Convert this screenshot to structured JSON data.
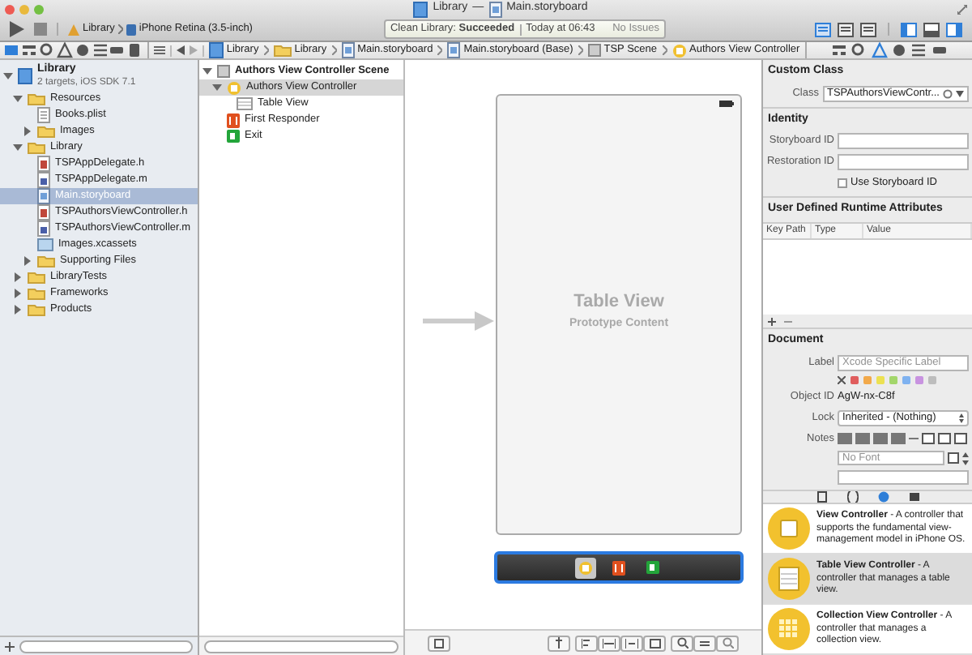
{
  "window": {
    "project": "Library",
    "separator": "—",
    "file": "Main.storyboard"
  },
  "toolbar": {
    "scheme_target": "Library",
    "scheme_device": "iPhone Retina (3.5-inch)",
    "activity": "Clean Library: **Succeeded**",
    "time": "Today at 06:43",
    "issues": "No Issues",
    "editor_modes": [
      {
        "selected": true
      },
      {
        "selected": false
      },
      {
        "selected": false
      }
    ],
    "views": [
      {
        "on": true
      },
      {
        "on": false
      },
      {
        "on": true
      }
    ]
  },
  "navigator_tabs": [
    {
      "selected": true
    },
    {
      "selected": false
    },
    {
      "selected": false
    },
    {
      "selected": false
    },
    {
      "selected": false
    },
    {
      "selected": false
    },
    {
      "selected": false
    },
    {
      "selected": false
    }
  ],
  "navigator": [
    {
      "label": "Library",
      "subtitle": "2 targets, iOS SDK 7.1",
      "kind": "project",
      "expanded": true,
      "selected": false,
      "children": [
        {
          "label": "Resources",
          "kind": "folder",
          "expanded": true,
          "selected": false,
          "children": [
            {
              "label": "Books.plist",
              "kind": "plist",
              "selected": false
            },
            {
              "label": "Images",
              "kind": "folder",
              "expanded": false,
              "selected": false
            }
          ]
        },
        {
          "label": "Library",
          "kind": "folder",
          "expanded": true,
          "selected": false,
          "children": [
            {
              "label": "TSPAppDelegate.h",
              "kind": "header",
              "selected": false
            },
            {
              "label": "TSPAppDelegate.m",
              "kind": "source",
              "selected": false
            },
            {
              "label": "Main.storyboard",
              "kind": "storyboard",
              "selected": true
            },
            {
              "label": "TSPAuthorsViewController.h",
              "kind": "header",
              "selected": false
            },
            {
              "label": "TSPAuthorsViewController.m",
              "kind": "source",
              "selected": false
            },
            {
              "label": "Images.xcassets",
              "kind": "assets",
              "selected": false
            },
            {
              "label": "Supporting Files",
              "kind": "folder",
              "expanded": false,
              "selected": false
            }
          ]
        },
        {
          "label": "LibraryTests",
          "kind": "folder",
          "expanded": false,
          "selected": false
        },
        {
          "label": "Frameworks",
          "kind": "folder",
          "expanded": false,
          "selected": false
        },
        {
          "label": "Products",
          "kind": "folder",
          "expanded": false,
          "selected": false
        }
      ]
    }
  ],
  "jump_bar": [
    {
      "label": "Library",
      "kind": "project"
    },
    {
      "label": "Library",
      "kind": "folder"
    },
    {
      "label": "Main.storyboard",
      "kind": "storyboard"
    },
    {
      "label": "Main.storyboard (Base)",
      "kind": "storyboard"
    },
    {
      "label": "TSP Scene",
      "kind": "scene"
    },
    {
      "label": "Authors View Controller",
      "kind": "controller"
    }
  ],
  "outline": [
    {
      "label": "Authors View Controller Scene",
      "kind": "scene",
      "expanded": true,
      "selected": false,
      "children": [
        {
          "label": "Authors View Controller",
          "kind": "controller",
          "expanded": true,
          "selected": true,
          "children": [
            {
              "label": "Table View",
              "kind": "tableview",
              "selected": false
            }
          ]
        },
        {
          "label": "First Responder",
          "kind": "responder",
          "selected": false
        },
        {
          "label": "Exit",
          "kind": "exit",
          "selected": false
        }
      ]
    }
  ],
  "canvas": {
    "scene_title": "Table View",
    "scene_subtitle": "Prototype Content",
    "dock": [
      {
        "kind": "controller",
        "selected": true
      },
      {
        "kind": "responder",
        "selected": false
      },
      {
        "kind": "exit",
        "selected": false
      }
    ]
  },
  "inspector_tabs": [
    {
      "selected": false
    },
    {
      "selected": false
    },
    {
      "selected": true
    },
    {
      "selected": false
    },
    {
      "selected": false
    },
    {
      "selected": false
    }
  ],
  "inspector": {
    "custom_class": {
      "title": "Custom Class",
      "class_label": "Class",
      "class_value": "TSPAuthorsViewContr..."
    },
    "identity": {
      "title": "Identity",
      "storyboard_id_label": "Storyboard ID",
      "restoration_id_label": "Restoration ID",
      "use_storyboard_id": {
        "label": "Use Storyboard ID",
        "checked": false
      }
    },
    "runtime_attributes": {
      "title": "User Defined Runtime Attributes",
      "columns": [
        "Key Path",
        "Type",
        "Value"
      ]
    },
    "document": {
      "title": "Document",
      "label_label": "Label",
      "label_placeholder": "Xcode Specific Label",
      "label_colors": [
        {
          "color": "#e05d5d"
        },
        {
          "color": "#f2a94a"
        },
        {
          "color": "#ece152"
        },
        {
          "color": "#a3d66b"
        },
        {
          "color": "#7fb2f0"
        },
        {
          "color": "#c893e0"
        },
        {
          "color": "#bdbdbd"
        }
      ],
      "object_id_label": "Object ID",
      "object_id": "AgW-nx-C8f",
      "lock_label": "Lock",
      "lock_value": "Inherited - (Nothing)",
      "notes_label": "Notes",
      "font_placeholder": "No Font"
    }
  },
  "library_tabs": [
    {
      "selected": false
    },
    {
      "selected": false
    },
    {
      "selected": true
    },
    {
      "selected": false
    }
  ],
  "library": [
    {
      "text": "**View Controller** - A controller that supports the fundamental view-management model in iPhone OS.",
      "kind": "view",
      "selected": false
    },
    {
      "text": "**Table View Controller** - A controller that manages a table view.",
      "kind": "table",
      "selected": true
    },
    {
      "text": "**Collection View Controller** - A controller that manages a collection view.",
      "kind": "collection",
      "selected": false
    }
  ]
}
